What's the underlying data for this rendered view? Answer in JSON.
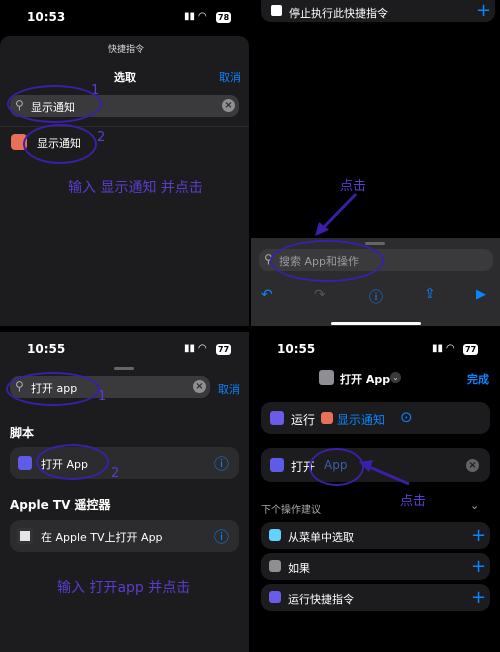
{
  "q1": {
    "time": "10:53",
    "battery": "78",
    "sheet_title": "快捷指令",
    "header_title": "选取",
    "cancel": "取消",
    "search_value": "显示通知",
    "result_label": "显示通知",
    "annot_1": "1",
    "annot_2": "2",
    "instruction": "输入 显示通知 并点击"
  },
  "q2": {
    "top_action": "停止执行此快捷指令",
    "annot_click": "点击",
    "search_placeholder": "搜索 App和操作"
  },
  "q3": {
    "time": "10:55",
    "battery": "77",
    "search_value": "打开 app",
    "cancel": "取消",
    "section1": "脚本",
    "item1": "打开 App",
    "section2": "Apple TV 遥控器",
    "item2": "在 Apple TV上打开 App",
    "annot_1": "1",
    "annot_2": "2",
    "instruction": "输入 打开app 并点击"
  },
  "q4": {
    "time": "10:55",
    "battery": "77",
    "shortcut_name": "打开 App",
    "done": "完成",
    "run_label": "运行",
    "run_param": "显示通知",
    "open_label": "打开",
    "open_param": "App",
    "annot_click": "点击",
    "suggest_header": "下个操作建议",
    "suggestions": [
      "从菜单中选取",
      "如果",
      "运行快捷指令"
    ]
  },
  "colors": {
    "accent": "#0a84ff",
    "annotation": "#5b3ccf",
    "background": "#000000",
    "row": "#1c1c1e"
  }
}
